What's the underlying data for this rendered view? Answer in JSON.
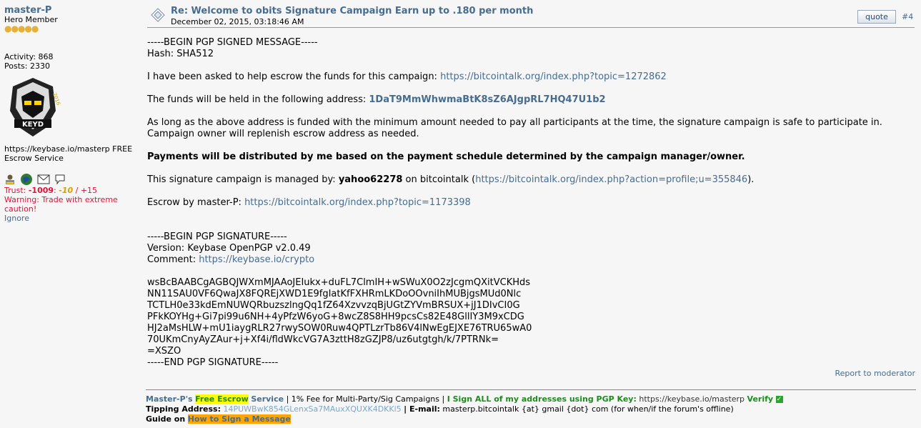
{
  "poster": {
    "name": "master-P",
    "rank": "Hero Member",
    "stars": "●●●●●",
    "activity": "Activity: 868",
    "posts": "Posts: 2330",
    "avatar_text": "KEYD",
    "avatar_year": "2016",
    "personal_text_1": "https://keybase.io/masterp FREE",
    "personal_text_2": "Escrow Service",
    "trust_label": "Trust:",
    "trust_neg": "-1009",
    "trust_sep": ":",
    "trust_mid": "-10",
    "trust_pos": "/ +15",
    "warning_1": "Warning: Trade with extreme",
    "warning_2": "caution!",
    "ignore": "Ignore"
  },
  "post": {
    "subject": "Re: Welcome to obits Signature Campaign Earn up to .180 per month",
    "date": "December 02, 2015, 03:18:46 AM",
    "quote_label": "quote",
    "number": "#4",
    "lines": {
      "begin": "-----BEGIN PGP SIGNED MESSAGE-----",
      "hash": "Hash: SHA512",
      "escrow_intro": "I have been asked to help escrow the funds for this campaign:",
      "escrow_link": "https://bitcointalk.org/index.php?topic=1272862",
      "funds_intro": "The funds will be held in the following address:",
      "funds_address": "1DaT9MmWhwmaBtK8sZ6AJgpRL7HQ47U1b2",
      "funded_1": "As long as the above address is funded with the minimum amount needed to pay all participants at the time, the signature campaign is safe to participate in.",
      "funded_2": "Campaign owner will replenish escrow address as needed.",
      "payments": "Payments will be distributed by me based on the payment schedule determined by the campaign manager/owner.",
      "managed_intro": "This signature campaign is managed by:",
      "managed_user": "yahoo62278",
      "managed_mid": "on bitcointalk (",
      "managed_link": "https://bitcointalk.org/index.php?action=profile;u=355846",
      "managed_end": ").",
      "escrowby_intro": "Escrow by master-P:",
      "escrowby_link": "https://bitcointalk.org/index.php?topic=1173398",
      "sig_begin": "-----BEGIN PGP SIGNATURE-----",
      "version": "Version: Keybase OpenPGP v2.0.49",
      "comment_intro": "Comment:",
      "comment_link": "https://keybase.io/crypto",
      "sig1": "wsBcBAABCgAGBQJWXmMJAAoJEIukx+duFL7ClmIH+wSWuX0O2zJcgmQXitVCKHds",
      "sig2": "NN11SAU0VF6QwaJX8FQREjXWD1E9fgIatKfFXHRmLKDoOOvniIhMUBjgsMUd0Nlc",
      "sig3": "TCTLH0e33kdEmNUWQRbuzszlngQq1fZ64XzvvzqBjUGtZYVmBRSUX+jJ1DIvCI0G",
      "sig4": "PFkKOYHg+Gi7pi99u6NH+4yPfzW6yoG+8wcZ8S8HH9pcsCs82E48GllIY3M9xCDG",
      "sig5": "HJ2aMsHLW+mU1iaygRLR27rwySOW0Ruw4QPTLzrTb86V4lNwEgEJXE76TRU65wA0",
      "sig6": "70UKmCnyAyZAur+j+Xf4i/fldWkcVG7A3zttH8zGZJP8/uz6utgtgh/k/7PTRNk=",
      "sig7": "=XSZO",
      "sig_end": "-----END PGP SIGNATURE-----"
    },
    "report": "Report to moderator"
  },
  "signature": {
    "owner": "Master-P's",
    "free_escrow": "Free Escrow",
    "service": "Service",
    "fee": "| 1% Fee for Multi-Party/Sig Campaigns |",
    "sign_all": "I Sign ALL of my addresses using PGP Key:",
    "keybase": "https://keybase.io/masterp",
    "verify": "Verify",
    "check": "✓",
    "tipping_label": "Tipping Address:",
    "tipping_address": "14PUWBwK854GLenxSa7MAuxXQUXK4DKKi5",
    "email_label": "| E-mail:",
    "email_value": "masterp.bitcointalk {at} gmail {dot} com (for when/if the forum's offline)",
    "guide_label": "Guide on",
    "guide_link": "How to Sign a Message"
  }
}
